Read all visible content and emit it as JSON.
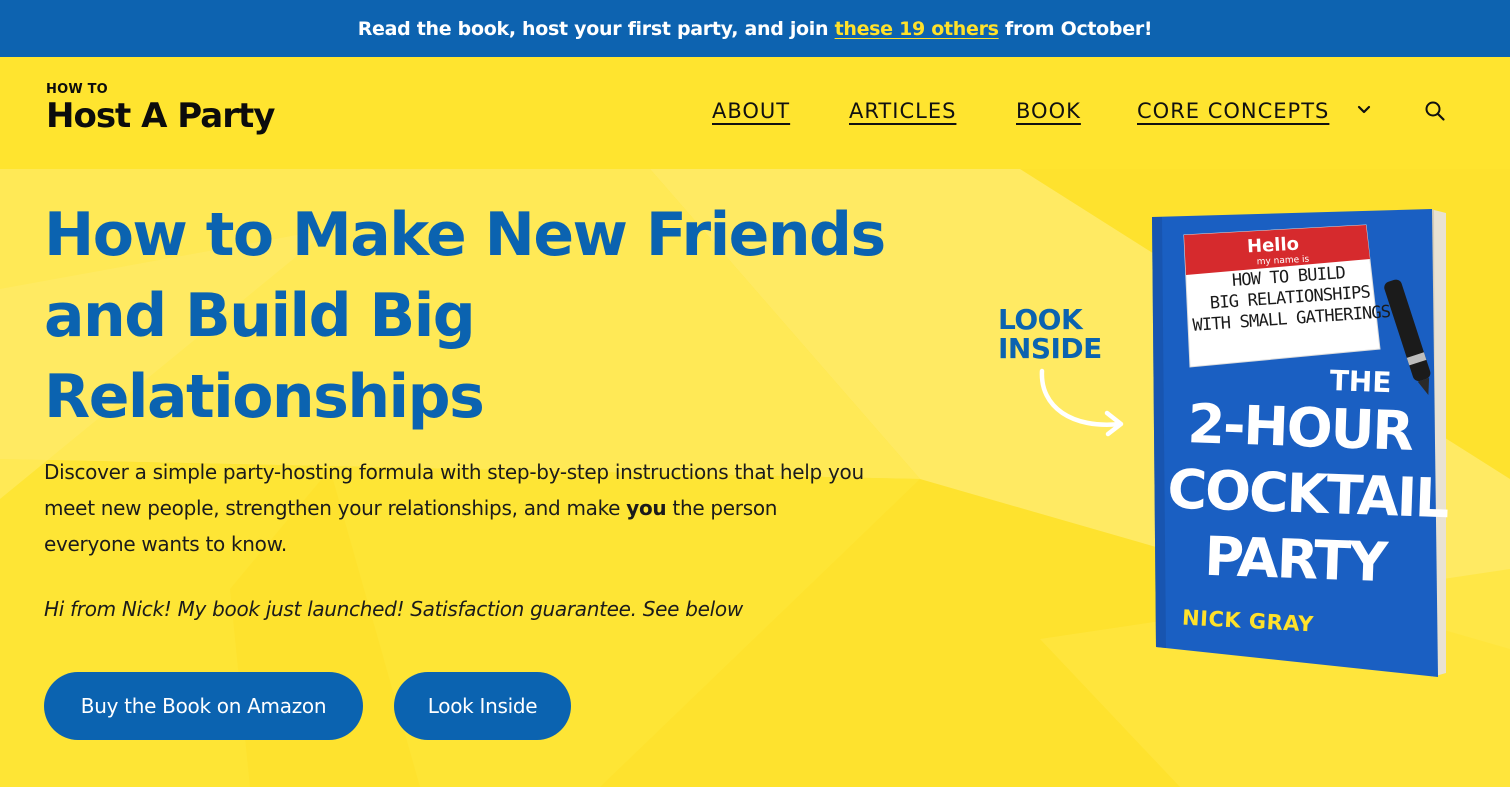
{
  "announcement": {
    "text_before": "Read the book, host your first party, and join ",
    "link_text": "these 19 others",
    "text_after": " from October!"
  },
  "header": {
    "logo_small": "HOW TO",
    "logo_big": "Host A Party",
    "nav": [
      {
        "label": "ABOUT"
      },
      {
        "label": "ARTICLES"
      },
      {
        "label": "BOOK"
      },
      {
        "label": "CORE CONCEPTS"
      }
    ],
    "icons": {
      "dropdown": "chevron-down-icon",
      "search": "search-icon"
    }
  },
  "hero": {
    "title": "How to Make New Friends and Build Big Relationships",
    "lead_before": "Discover a simple party-hosting formula with step-by-step instructions that help you meet new people, strengthen your relationships, and make ",
    "lead_bold": "you",
    "lead_after": " the person everyone wants to know.",
    "note": "Hi from Nick! My book just launched! Satisfaction guarantee. See below",
    "buttons": {
      "amazon": "Buy the Book on Amazon",
      "look_inside": "Look Inside"
    },
    "look_inside_callout": "LOOK INSIDE"
  },
  "book": {
    "tag_hello": "Hello",
    "tag_my_name": "my name is",
    "tag_subtitle": "HOW TO BUILD\nBIG RELATIONSHIPS\nWITH SMALL GATHERINGS",
    "title_the": "THE",
    "title_line1": "2-HOUR",
    "title_line2": "COCKTAIL",
    "title_line3": "PARTY",
    "author": "NICK GRAY"
  },
  "colors": {
    "brand_blue": "#0b63b0",
    "brand_yellow": "#ffe42f",
    "link_yellow": "#ffe12a"
  }
}
